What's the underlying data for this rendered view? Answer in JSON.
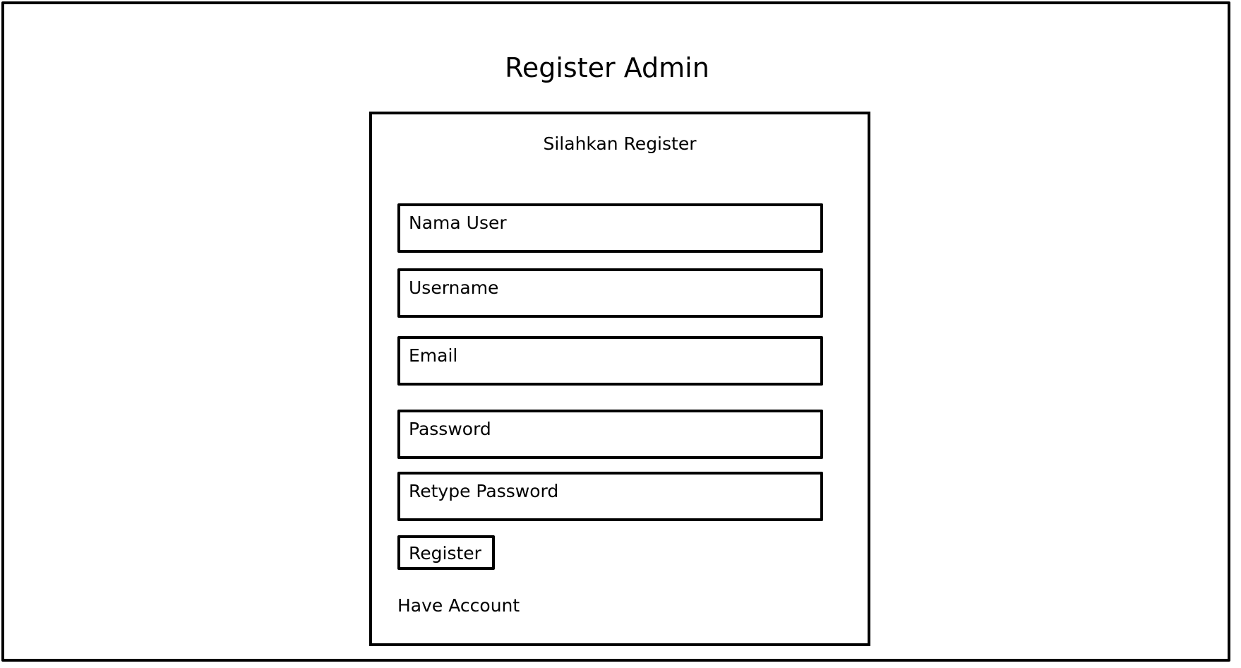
{
  "page": {
    "title": "Register Admin"
  },
  "form": {
    "heading": "Silahkan Register",
    "fields": [
      {
        "placeholder": "Nama User"
      },
      {
        "placeholder": "Username"
      },
      {
        "placeholder": "Email"
      },
      {
        "placeholder": "Password"
      },
      {
        "placeholder": "Retype Password"
      }
    ],
    "submit_label": "Register",
    "login_link_label": "Have Account"
  },
  "colors": {
    "stroke": "#000000",
    "background": "#ffffff"
  }
}
